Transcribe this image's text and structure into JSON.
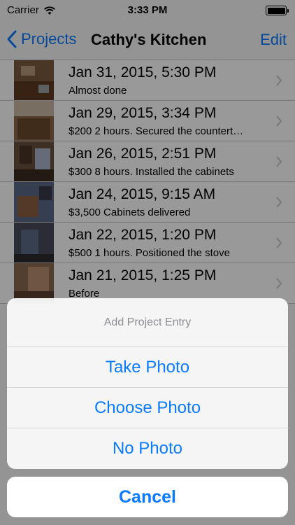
{
  "status": {
    "carrier": "Carrier",
    "time": "3:33 PM"
  },
  "nav": {
    "back_label": "Projects",
    "title": "Cathy's Kitchen",
    "edit_label": "Edit"
  },
  "entries": [
    {
      "date": "Jan 31, 2015, 5:30 PM",
      "note": "Almost done"
    },
    {
      "date": "Jan 29, 2015, 3:34 PM",
      "note": "$200 2 hours. Secured the countert…"
    },
    {
      "date": "Jan 26, 2015, 2:51 PM",
      "note": "$300 8 hours. Installed the cabinets"
    },
    {
      "date": "Jan 24, 2015, 9:15 AM",
      "note": "$3,500 Cabinets delivered"
    },
    {
      "date": "Jan 22, 2015, 1:20 PM",
      "note": "$500 1 hours. Positioned the stove"
    },
    {
      "date": "Jan 21, 2015, 1:25 PM",
      "note": "Before"
    }
  ],
  "sheet": {
    "title": "Add Project Entry",
    "take_photo": "Take Photo",
    "choose_photo": "Choose Photo",
    "no_photo": "No Photo",
    "cancel": "Cancel"
  },
  "colors": {
    "accent": "#0a7aff",
    "dim_overlay": "rgba(0,0,0,0.40)"
  },
  "icons": [
    "wifi-icon",
    "battery-icon",
    "back-chevron-icon",
    "disclosure-chevron-icon"
  ]
}
